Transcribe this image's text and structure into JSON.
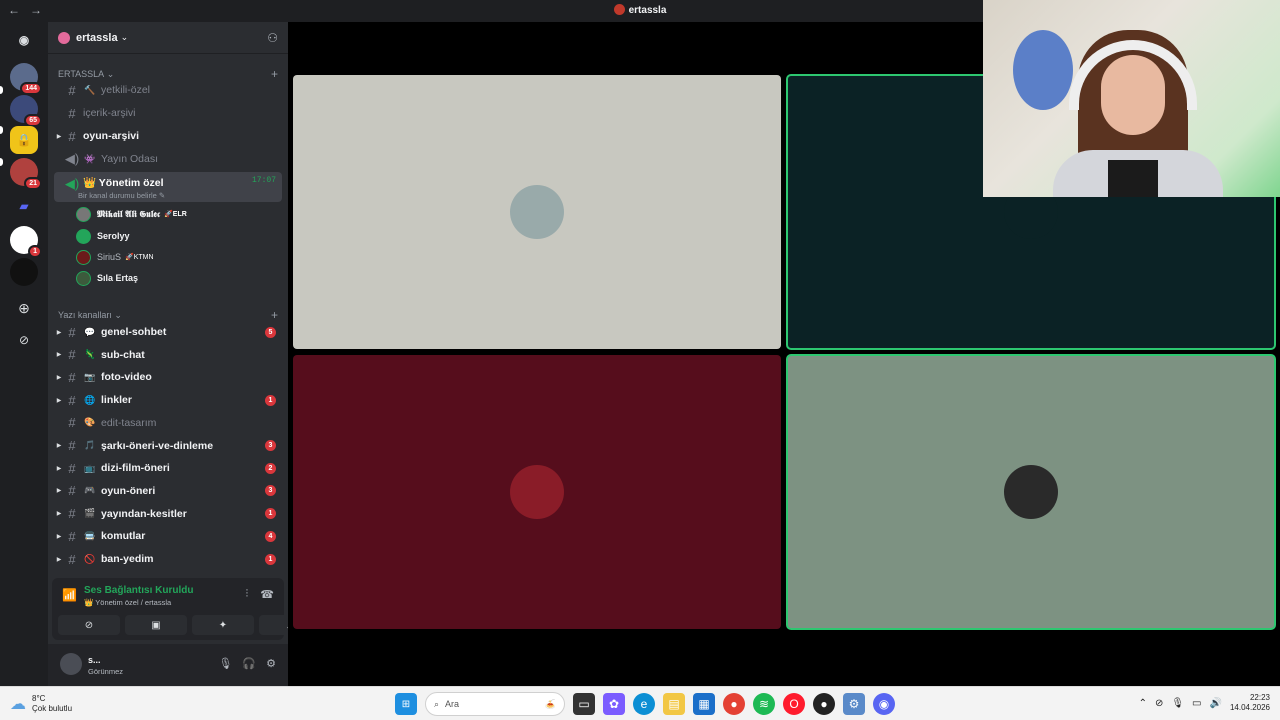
{
  "window": {
    "title": "ertassla",
    "back": "←",
    "forward": "→"
  },
  "guilds": [
    {
      "badge": "144",
      "color": "#5b6b8c",
      "icon": "server-avatar"
    },
    {
      "badge": "65",
      "color": "#3c4a7a",
      "icon": "server-avatar"
    },
    {
      "badge": "",
      "color": "#f0c419",
      "icon": "lock-icon"
    },
    {
      "badge": "21",
      "color": "#b0413e",
      "icon": "server-avatar"
    },
    {
      "badge": "",
      "color": "#5865f2",
      "icon": "folder-icon"
    },
    {
      "badge": "1",
      "color": "#ffffff",
      "icon": "server-avatar"
    },
    {
      "badge": "",
      "color": "#111111",
      "icon": "server-avatar"
    }
  ],
  "server": {
    "name": "ertassla",
    "chevron": "⌄"
  },
  "categories": {
    "top": "ERTASSLA",
    "text": "Yazı kanalları"
  },
  "channels_top": [
    {
      "emoji": "🔨",
      "label": "yetkili-özel",
      "bold": false
    },
    {
      "emoji": "",
      "label": "içerik-arşivi",
      "bold": false
    },
    {
      "emoji": "",
      "label": "oyun-arşivi",
      "bold": true
    },
    {
      "emoji": "👾",
      "label": "Yayın Odası",
      "bold": false
    }
  ],
  "active_voice": {
    "label": "👑 Yönetim özel",
    "status": "Bir kanal durumu belirle ✎",
    "time": "17:07"
  },
  "voice_users": [
    {
      "name": "𝕸𝖎𝖐𝖆𝖎𝖑 𝕬𝖑𝖎 𝕲𝖚𝖑𝖊𝖈",
      "tag": "🚀ELR",
      "color": "#777"
    },
    {
      "name": "Serolyy",
      "tag": "",
      "color": "#23a55a"
    },
    {
      "name": "SiriuS",
      "tag": "🚀KTMN",
      "color": "#6b1a1a"
    },
    {
      "name": "Sıla Ertaş",
      "tag": "",
      "color": "#3c5a3c"
    }
  ],
  "text_channels": [
    {
      "emoji": "💬",
      "label": "genel-sohbet",
      "count": "5"
    },
    {
      "emoji": "🦎",
      "label": "sub-chat",
      "count": ""
    },
    {
      "emoji": "📷",
      "label": "foto-video",
      "count": ""
    },
    {
      "emoji": "🌐",
      "label": "linkler",
      "count": "1"
    },
    {
      "emoji": "🎨",
      "label": "edit-tasarım",
      "count": ""
    },
    {
      "emoji": "🎵",
      "label": "şarkı-öneri-ve-dinleme",
      "count": "3"
    },
    {
      "emoji": "📺",
      "label": "dizi-film-öneri",
      "count": "2"
    },
    {
      "emoji": "🎮",
      "label": "oyun-öneri",
      "count": "3"
    },
    {
      "emoji": "🎬",
      "label": "yayından-kesitler",
      "count": "1"
    },
    {
      "emoji": "🚍",
      "label": "komutlar",
      "count": "4"
    },
    {
      "emoji": "🚫",
      "label": "ban-yedim",
      "count": "1"
    }
  ],
  "voice_panel": {
    "status": "Ses Bağlantısı Kuruldu",
    "location": "👑 Yönetim özel / ertassla"
  },
  "user_panel": {
    "name": "s...",
    "status": "Görünmez"
  },
  "tiles": [
    {
      "bg": "#c8c8c0",
      "speaking": false,
      "avatar": "#9aa"
    },
    {
      "bg": "#0b2225",
      "speaking": true,
      "avatar": "#0b2225"
    },
    {
      "bg": "#560d1c",
      "speaking": false,
      "avatar": "#8a1c28"
    },
    {
      "bg": "#7d9282",
      "speaking": true,
      "avatar": "#2a2a2a"
    }
  ],
  "taskbar": {
    "temp": "8°C",
    "weather": "Çok bulutlu",
    "search_placeholder": "Ara",
    "time": "22:23",
    "date": "14.04.2026"
  }
}
